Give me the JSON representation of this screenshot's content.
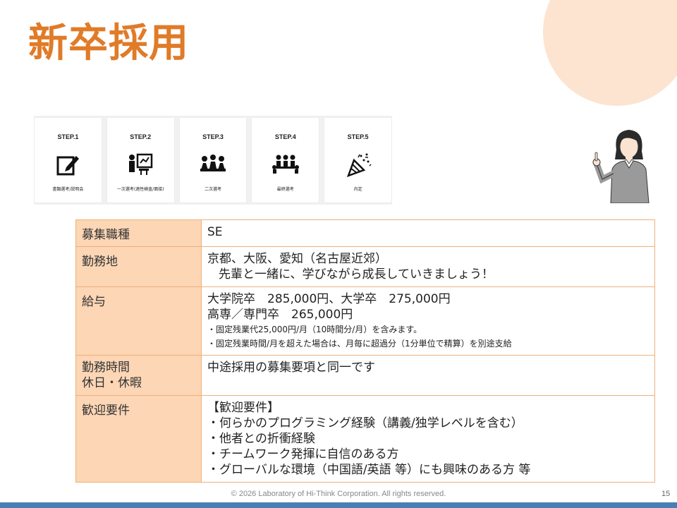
{
  "title": "新卒採用",
  "steps": [
    {
      "num": "STEP.1",
      "label": "書類選考/説明会",
      "icon": "document-pen-icon"
    },
    {
      "num": "STEP.2",
      "label": "一次選考(適性検査/面接)",
      "icon": "test-board-icon"
    },
    {
      "num": "STEP.3",
      "label": "二次選考",
      "icon": "group-interview-icon"
    },
    {
      "num": "STEP.4",
      "label": "最終選考",
      "icon": "final-interview-icon"
    },
    {
      "num": "STEP.5",
      "label": "内定",
      "icon": "party-popper-icon"
    }
  ],
  "table": {
    "job_type": {
      "label": "募集職種",
      "value": "SE"
    },
    "location": {
      "label": "勤務地",
      "value1": "京都、大阪、愛知（名古屋近郊）",
      "value2": "先輩と一緒に、学びながら成長していきましょう！"
    },
    "salary": {
      "label": "給与",
      "line1": "大学院卒　285,000円、大学卒　275,000円",
      "line2": "高専／専門卒　265,000円",
      "note1": "・固定残業代25,000円/月（10時間分/月）を含みます。",
      "note2": "・固定残業時間/月を超えた場合は、月毎に超過分（1分単位で精算）を別途支給"
    },
    "hours": {
      "label1": "勤務時間",
      "label2": "休日・休暇",
      "value": "中途採用の募集要項と同一です"
    },
    "requirements": {
      "label": "歓迎要件",
      "heading": "【歓迎要件】",
      "items": [
        "・何らかのプログラミング経験（講義/独学レベルを含む）",
        "・他者との折衝経験",
        "・チームワーク発揮に自信のある方",
        "・グローバルな環境（中国語/英語 等）にも興味のある方 等"
      ]
    }
  },
  "footer": "© 2026 Laboratory of Hi-Think Corporation. All rights reserved.",
  "page_number": "15",
  "colors": {
    "accent": "#e07b28",
    "table_header": "#fcd6b5",
    "table_border": "#f0b07a",
    "bottom_bar": "#4a7fb5",
    "circle": "#fce4d0"
  }
}
